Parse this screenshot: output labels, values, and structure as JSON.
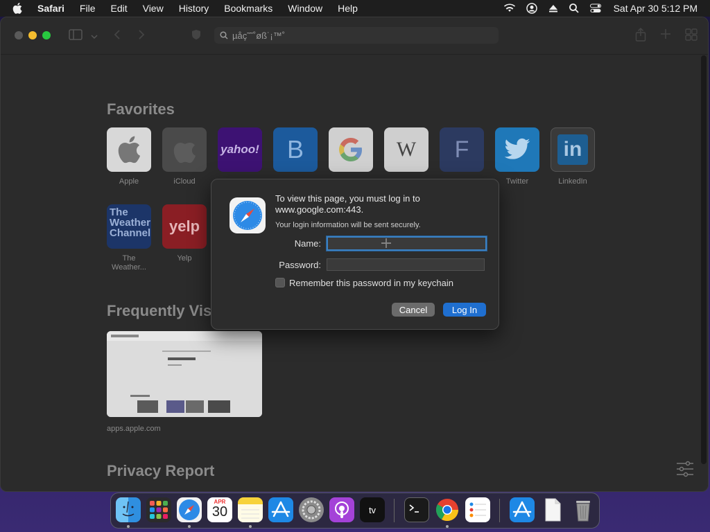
{
  "menubar": {
    "items": [
      "Safari",
      "File",
      "Edit",
      "View",
      "History",
      "Bookmarks",
      "Window",
      "Help"
    ],
    "clock": "Sat Apr 30  5:12 PM"
  },
  "toolbar": {
    "address_text": "µåç˜˜˚øß˙¡™˚"
  },
  "favorites": {
    "title": "Favorites",
    "items": [
      {
        "label": "Apple",
        "tile": ""
      },
      {
        "label": "iCloud",
        "tile": ""
      },
      {
        "label": "",
        "tile": "yahoo!"
      },
      {
        "label": "",
        "tile": "B"
      },
      {
        "label": "",
        "tile": "G"
      },
      {
        "label": "",
        "tile": "W"
      },
      {
        "label": "",
        "tile": "F"
      },
      {
        "label": "Twitter",
        "tile": ""
      },
      {
        "label": "LinkedIn",
        "tile": "in"
      },
      {
        "label": "The Weather...",
        "tile": "The Weather Channel"
      },
      {
        "label": "Yelp",
        "tile": "yelp"
      }
    ]
  },
  "frequently_visited": {
    "title": "Frequently Visi",
    "url": "apps.apple.com"
  },
  "privacy": {
    "title": "Privacy Report"
  },
  "dialog": {
    "message": "To view this page, you must log in to www.google.com:443.",
    "sub": "Your login information will be sent securely.",
    "name_label": "Name:",
    "password_label": "Password:",
    "remember_label": "Remember this password in my keychain",
    "cancel_label": "Cancel",
    "login_label": "Log In",
    "name_value": "",
    "password_value": ""
  },
  "dock": {
    "calendar_month": "APR",
    "calendar_day": "30",
    "tv_label": "tv"
  },
  "colors": {
    "accent": "#1f6fd0",
    "focus": "#3b82c4"
  }
}
